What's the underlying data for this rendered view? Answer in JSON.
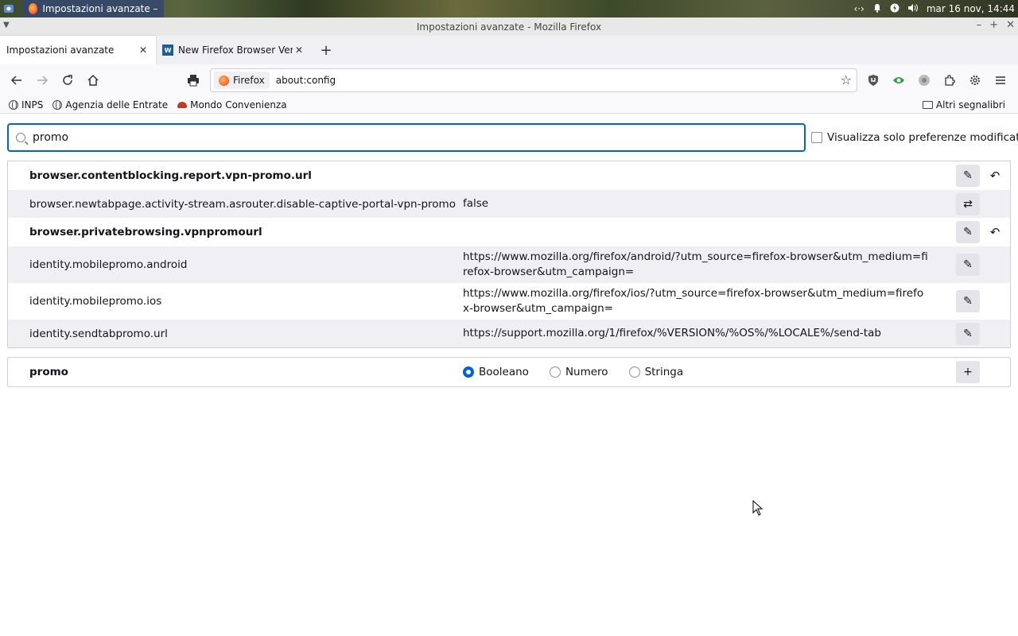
{
  "panel": {
    "task_title": "Impostazioni avanzate – Mo...",
    "datetime": "mar 16 nov, 14:44",
    "tray_icons": [
      "network-icon",
      "notification-bell-icon",
      "power-icon",
      "volume-icon"
    ]
  },
  "window": {
    "title": "Impostazioni avanzate - Mozilla Firefox"
  },
  "tabs": [
    {
      "label": "Impostazioni avanzate",
      "active": true
    },
    {
      "label": "New Firefox Browser Version",
      "active": false
    }
  ],
  "urlbar": {
    "identity": "Firefox",
    "url": "about:config"
  },
  "bookmarks": {
    "items": [
      "INPS",
      "Agenzia delle Entrate",
      "Mondo Convenienza"
    ],
    "others": "Altri segnalibri"
  },
  "config": {
    "search_value": "promo",
    "show_modified_label": "Visualizza solo preferenze modificate",
    "prefs": [
      {
        "name": "browser.contentblocking.report.vpn-promo.url",
        "value": "",
        "modified": true
      },
      {
        "name": "browser.newtabpage.activity-stream.asrouter.disable-captive-portal-vpn-promo",
        "value": "false",
        "modified": false
      },
      {
        "name": "browser.privatebrowsing.vpnpromourl",
        "value": "",
        "modified": true
      },
      {
        "name": "identity.mobilepromo.android",
        "value": "https://www.mozilla.org/firefox/android/?utm_source=firefox-browser&utm_medium=firefox-browser&utm_campaign=",
        "modified": false
      },
      {
        "name": "identity.mobilepromo.ios",
        "value": "https://www.mozilla.org/firefox/ios/?utm_source=firefox-browser&utm_medium=firefox-browser&utm_campaign=",
        "modified": false
      },
      {
        "name": "identity.sendtabpromo.url",
        "value": "https://support.mozilla.org/1/firefox/%VERSION%/%OS%/%LOCALE%/send-tab",
        "modified": false
      }
    ],
    "new_pref": {
      "name": "promo",
      "types": [
        "Booleano",
        "Numero",
        "Stringa"
      ],
      "selected": "Booleano"
    }
  }
}
